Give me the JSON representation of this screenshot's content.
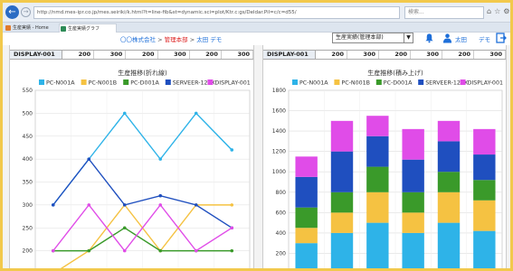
{
  "browser": {
    "url": "http://nmd.mes-ipr.co.jp/mes.seiriki/k.html?t=line-fib&st=dynamic.sci=plot/Ktr.c:gs/Deldar.Pil=c/c=d55/",
    "search_placeholder": "検索...",
    "tabs": [
      {
        "label": "生産実績 - Home"
      },
      {
        "label": "生産実績グラフ"
      }
    ]
  },
  "header": {
    "company": "〇〇株式会社",
    "sep1": ">",
    "dept": "管理本部",
    "sep2": ">",
    "user_crumb": "太田",
    "demo_crumb": "デモ",
    "select_value": "生産実績(管理本部)",
    "user_name": "太田",
    "demo_label": "デモ"
  },
  "left_panel": {
    "row_label": "DISPLAY-001",
    "row_values": [
      "200",
      "300",
      "200",
      "300",
      "200",
      "300"
    ]
  },
  "right_panel": {
    "row_label": "DISPLAY-001",
    "row_values": [
      "200",
      "300",
      "200",
      "300",
      "200",
      "300"
    ]
  },
  "colors": {
    "PC-N001A": "#2eb3e8",
    "PC-N001B": "#f5c242",
    "PC-D001A": "#3a9a2a",
    "SERVEER-120X": "#1f4fbf",
    "DISPLAY-001": "#e04ce8"
  },
  "chart_data": [
    {
      "type": "line",
      "title": "生産推移(折れ線)",
      "ylim": [
        150,
        550
      ],
      "yticks": [
        150,
        200,
        250,
        300,
        350,
        400,
        450,
        500,
        550
      ],
      "grid": true,
      "legend_position": "top",
      "series": [
        {
          "name": "PC-N001A",
          "values": [
            300,
            400,
            500,
            400,
            500,
            420
          ]
        },
        {
          "name": "PC-N001B",
          "values": [
            150,
            200,
            300,
            200,
            300,
            300
          ]
        },
        {
          "name": "PC-D001A",
          "values": [
            200,
            200,
            250,
            200,
            200,
            200
          ]
        },
        {
          "name": "SERVEER-120X",
          "values": [
            300,
            400,
            300,
            320,
            300,
            250
          ]
        },
        {
          "name": "DISPLAY-001",
          "values": [
            200,
            300,
            200,
            300,
            200,
            250
          ]
        }
      ]
    },
    {
      "type": "bar",
      "stacked": true,
      "title": "生産推移(積み上げ)",
      "ylim": [
        0,
        1800
      ],
      "yticks": [
        0,
        200,
        400,
        600,
        800,
        1000,
        1200,
        1400,
        1600,
        1800
      ],
      "grid": true,
      "legend_position": "top",
      "series": [
        {
          "name": "PC-N001A",
          "values": [
            300,
            400,
            500,
            400,
            500,
            420
          ]
        },
        {
          "name": "PC-N001B",
          "values": [
            150,
            200,
            300,
            200,
            300,
            300
          ]
        },
        {
          "name": "PC-D001A",
          "values": [
            200,
            200,
            250,
            200,
            200,
            200
          ]
        },
        {
          "name": "SERVEER-120X",
          "values": [
            300,
            400,
            300,
            320,
            300,
            250
          ]
        },
        {
          "name": "DISPLAY-001",
          "values": [
            200,
            300,
            200,
            300,
            200,
            250
          ]
        }
      ]
    }
  ]
}
